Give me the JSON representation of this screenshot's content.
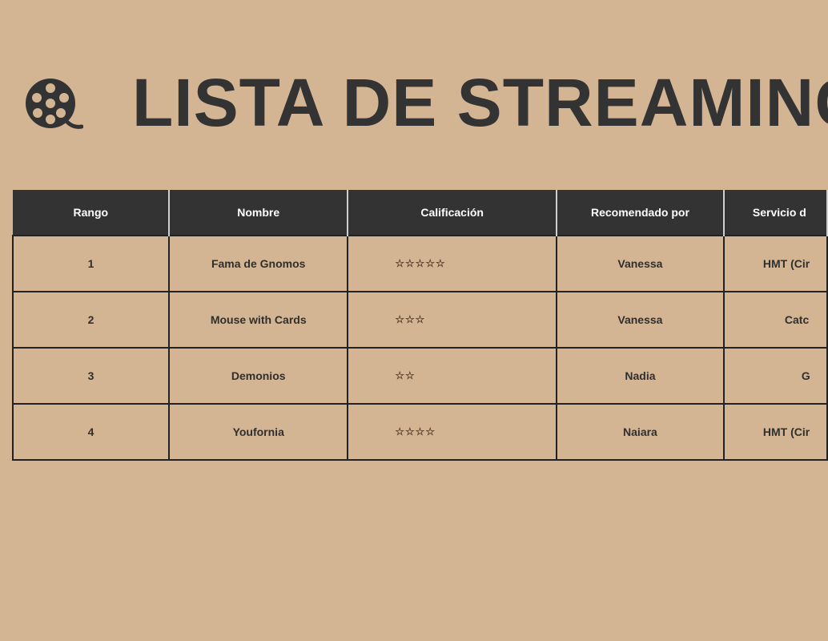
{
  "header": {
    "title": "LISTA DE STREAMING",
    "logo_icon": "film-reel-search-icon"
  },
  "table": {
    "columns": [
      "Rango",
      "Nombre",
      "Calificación",
      "Recomendado por",
      "Servicio d"
    ],
    "rows": [
      {
        "rank": "1",
        "name": "Fama de Gnomos",
        "rating": "☆☆☆☆☆",
        "rating_value": 5,
        "recommended_by": "Vanessa",
        "service": "HMT (Cir"
      },
      {
        "rank": "2",
        "name": "Mouse with Cards",
        "rating": "☆☆☆",
        "rating_value": 3,
        "recommended_by": "Vanessa",
        "service": "Catc"
      },
      {
        "rank": "3",
        "name": "Demonios",
        "rating": "☆☆",
        "rating_value": 2,
        "recommended_by": "Nadia",
        "service": "G"
      },
      {
        "rank": "4",
        "name": "Youfornia",
        "rating": "☆☆☆☆",
        "rating_value": 4,
        "recommended_by": "Naiara",
        "service": "HMT (Cir"
      }
    ]
  },
  "colors": {
    "background": "#d3b594",
    "header_bg": "#333333",
    "text": "#2f2f2f"
  }
}
